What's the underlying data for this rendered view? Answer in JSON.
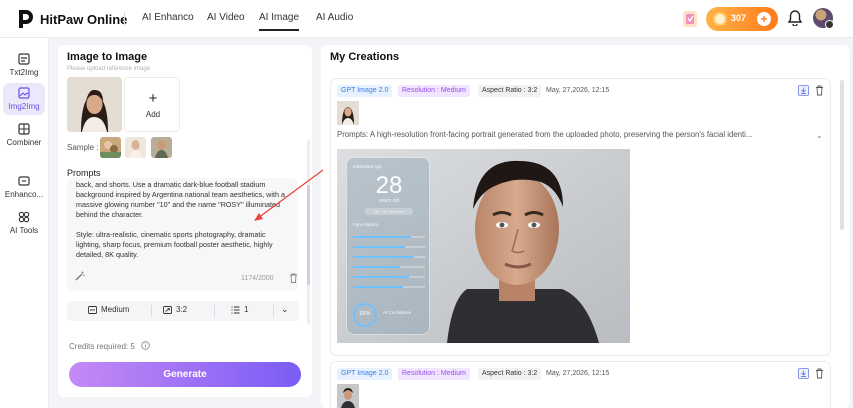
{
  "topbar": {
    "brand": "HitPaw Online",
    "nav": [
      "AI Enhanco",
      "AI Video",
      "AI Image",
      "AI Audio"
    ],
    "active_nav": "AI Image",
    "credits": "307"
  },
  "sidebar": {
    "items": [
      {
        "label": "Txt2Img",
        "icon": "text-to-image-icon"
      },
      {
        "label": "Img2Img",
        "icon": "image-to-image-icon"
      },
      {
        "label": "Combiner",
        "icon": "combiner-icon"
      },
      {
        "label": "Enhanco...",
        "icon": "enhance-icon"
      },
      {
        "label": "AI Tools",
        "icon": "ai-tools-icon"
      }
    ]
  },
  "left": {
    "title": "Image to Image",
    "faded_hint": "Please upload reference image",
    "add_label": "Add",
    "sample_label": "Sample :",
    "prompts_label": "Prompts",
    "prompt_paragraph_1": "back, and shorts. Use a dramatic dark-blue football stadium background inspired by Argentina national team aesthetics, with a massive glowing number \"10\" and the name \"ROSY\" illuminated behind the character.",
    "prompt_paragraph_2": "Style: ultra-realistic, cinematic sports photography, dramatic lighting, sharp focus, premium football poster aesthetic, highly detailed, 8K quality.",
    "char_count": "1174/2000",
    "settings": {
      "resolution": "Medium",
      "aspect": "3:2",
      "count": "1"
    },
    "credits_required": "Credits required: 5",
    "generate_label": "Generate"
  },
  "right": {
    "title": "My Creations",
    "cards": [
      {
        "model": "GPT Image 2.0",
        "resolution": "Resolution : Medium",
        "aspect": "Aspect Ratio : 3:2",
        "date": "May, 27,2026, 12:15",
        "prompt": "Prompts: A high-resolution front-facing portrait generated from the uploaded photo, preserving the person's facial identi..."
      },
      {
        "model": "GPT Image 2.0",
        "resolution": "Resolution : Medium",
        "aspect": "Aspect Ratio : 3:2",
        "date": "May, 27,2026, 12:15"
      }
    ],
    "overlay_card": {
      "heading": "Estimated Age",
      "age": "28",
      "age_sub": "years old",
      "range": "26 ~ 30 years old",
      "metrics_title": "Face Metrics",
      "confidence": "93%",
      "confidence_label": "AI Confidence"
    }
  },
  "colors": {
    "accent_purple": "#7a5cf5",
    "credits_orange": "#ff7a1a",
    "annotation_red": "#e8453c"
  }
}
